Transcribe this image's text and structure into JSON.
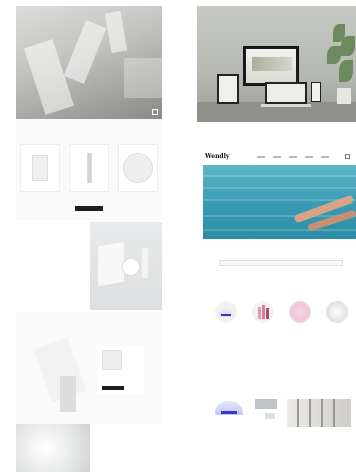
{
  "left_page": {
    "hero": {
      "logo": "",
      "caption": ""
    },
    "sections": {
      "products_title": "",
      "device_title": ""
    },
    "feature": {
      "kicker": "",
      "headline": "",
      "link": ""
    },
    "device_panel": {
      "label": ""
    },
    "bottom": {
      "kicker": "",
      "name": ""
    }
  },
  "right_hero": {
    "title": ""
  },
  "right_site": {
    "brand": "Wendly",
    "banner_caption": "",
    "search_label": "",
    "search_placeholder": "",
    "categories_title": "",
    "categories": [
      {
        "label": "",
        "color": "#3a35c9"
      },
      {
        "label": "",
        "color": "#e49bb0"
      },
      {
        "label": "",
        "color": "#f0c6d6"
      },
      {
        "label": "",
        "color": "#dcdcdc"
      }
    ],
    "feature_title": ""
  }
}
